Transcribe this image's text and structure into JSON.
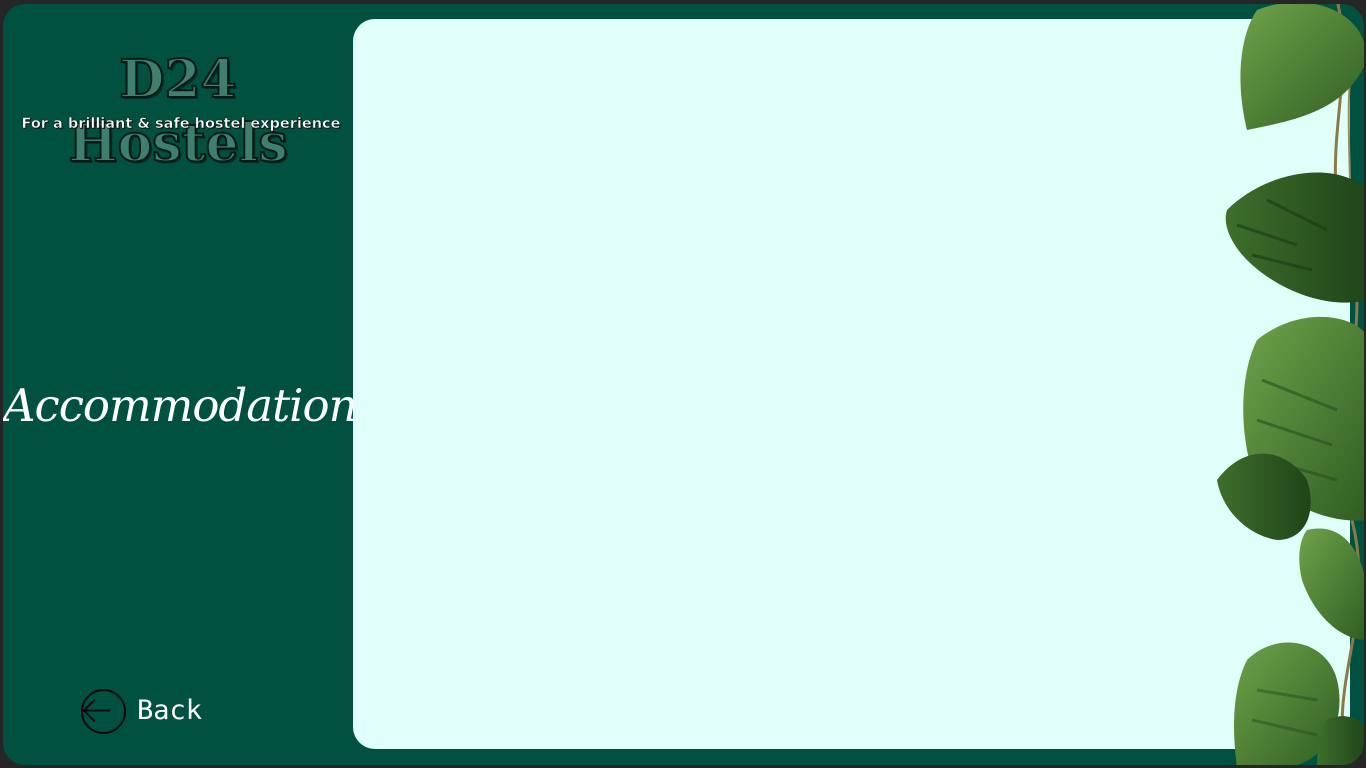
{
  "app": {
    "brand": {
      "title": "D24 Hostels",
      "tagline": "For a brilliant & safe hostel experience"
    },
    "sidebar": {
      "section_title": "Accommodations",
      "back_label": "Back",
      "back_icon": "arrow-left-circle-icon"
    },
    "main": {
      "content": ""
    },
    "decoration": {
      "name": "monstera-leaves-decoration"
    },
    "colors": {
      "background": "#005140",
      "panel": "#e0fff8",
      "text": "#ffffff",
      "frame": "#262626"
    }
  }
}
